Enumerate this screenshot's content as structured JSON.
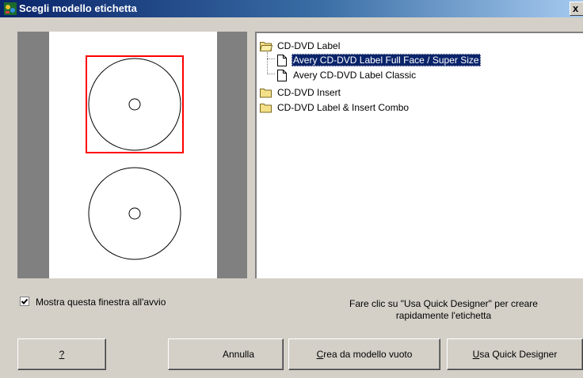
{
  "window": {
    "title": "Scegli modello etichetta",
    "close_label": "x"
  },
  "preview": {
    "selected_label_index": 0
  },
  "tree": {
    "items": [
      {
        "label": "CD-DVD Label",
        "type": "folder",
        "level": 0,
        "expanded": true
      },
      {
        "label": "Avery CD-DVD Label Full Face / Super Size",
        "type": "document",
        "level": 1,
        "selected": true
      },
      {
        "label": "Avery CD-DVD Label Classic",
        "type": "document",
        "level": 1
      },
      {
        "label": "CD-DVD Insert",
        "type": "folder",
        "level": 0
      },
      {
        "label": "CD-DVD Label & Insert Combo",
        "type": "folder",
        "level": 0
      }
    ]
  },
  "startup_checkbox": {
    "label": "Mostra questa finestra all'avvio",
    "checked": true
  },
  "hint": {
    "line1": "Fare clic su \"Usa Quick Designer\" per creare",
    "line2": "rapidamente l'etichetta"
  },
  "buttons": {
    "help": "?",
    "cancel": "Annulla",
    "blank_prefix": "C",
    "blank_rest": "rea da modello vuoto",
    "quick_prefix": "U",
    "quick_rest": "sa Quick Designer"
  },
  "colors": {
    "dialog_bg": "#d4d0c8",
    "title_start": "#0a246a",
    "title_end": "#a6caf0",
    "selection": "#0a246a",
    "highlight_frame": "#ff0000"
  }
}
